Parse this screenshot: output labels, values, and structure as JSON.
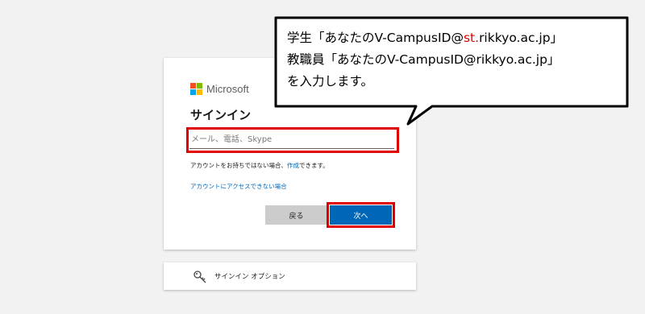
{
  "brand": {
    "name": "Microsoft",
    "colors": [
      "#f25022",
      "#7fba00",
      "#00a4ef",
      "#ffb900"
    ]
  },
  "signin": {
    "title": "サインイン",
    "email_placeholder": "メール、電話、Skype",
    "no_account_prefix": "アカウントをお持ちではない場合、",
    "create_link": "作成",
    "no_account_suffix": "できます。",
    "cant_access_link": "アカウントにアクセスできない場合",
    "back_label": "戻る",
    "next_label": "次へ"
  },
  "options": {
    "icon": "key-icon",
    "label": "サインイン オプション"
  },
  "callout": {
    "line1_prefix": "学生「あなたのV-CampusID@",
    "line1_highlight": "st.",
    "line1_suffix": "rikkyo.ac.jp」",
    "line2": "教職員「あなたのV-CampusID@rikkyo.ac.jp」",
    "line3": "を入力します。"
  },
  "colors": {
    "accent": "#0067b8",
    "highlight": "#e00000",
    "background": "#f2f2f2"
  }
}
